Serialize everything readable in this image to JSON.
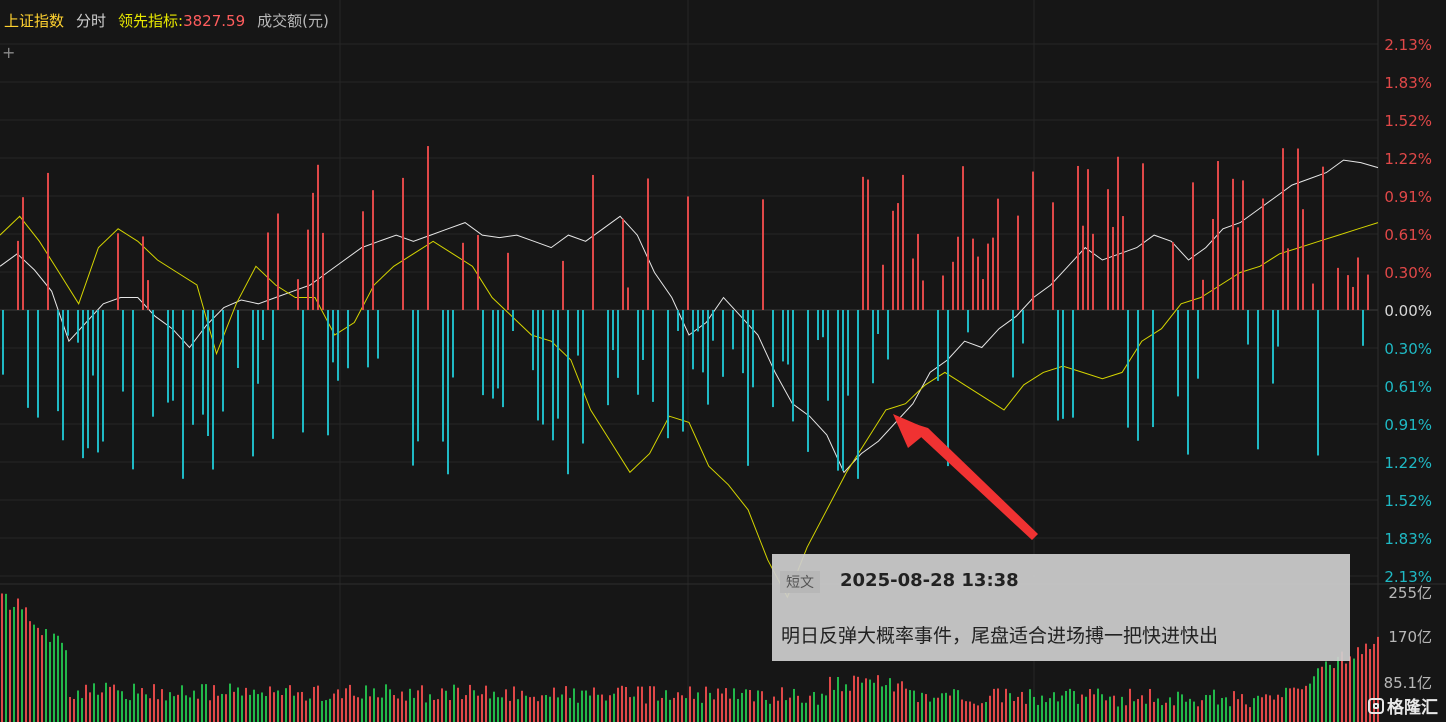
{
  "header": {
    "title": "上证指数",
    "mode": "分时",
    "leading_label": "领先指标:",
    "leading_value": "3827.59",
    "volume_label": "成交额(元)"
  },
  "chart_data": {
    "type": "line",
    "x": [
      0,
      3,
      6,
      9,
      12,
      15,
      18,
      21,
      24,
      27,
      30,
      33,
      36,
      39,
      42,
      45,
      48,
      51,
      54,
      57,
      60,
      63,
      66,
      69,
      72,
      75,
      78,
      81,
      84,
      87,
      90,
      93,
      96,
      99,
      102,
      105,
      108,
      111,
      114,
      117,
      120,
      123,
      126,
      129,
      132,
      135,
      138,
      141,
      144,
      147,
      150,
      153,
      156,
      159,
      162,
      165,
      168,
      171,
      174,
      177,
      180,
      183,
      186,
      189,
      192,
      195,
      198,
      201,
      204,
      207,
      210,
      213,
      216,
      219,
      222,
      225,
      228,
      231,
      234,
      237,
      240
    ],
    "y_range_pct": [
      -2.13,
      2.13
    ],
    "series": [
      {
        "color": "#e6e6e6",
        "values": [
          0.35,
          0.45,
          0.32,
          0.15,
          -0.25,
          -0.1,
          0.05,
          0.1,
          0.1,
          -0.05,
          -0.15,
          -0.3,
          -0.12,
          0.02,
          0.08,
          0.05,
          0.1,
          0.15,
          0.2,
          0.3,
          0.4,
          0.5,
          0.55,
          0.6,
          0.55,
          0.6,
          0.65,
          0.7,
          0.6,
          0.58,
          0.6,
          0.55,
          0.5,
          0.6,
          0.55,
          0.65,
          0.75,
          0.6,
          0.3,
          0.1,
          -0.2,
          -0.1,
          0.1,
          -0.05,
          -0.2,
          -0.5,
          -0.75,
          -0.85,
          -1.0,
          -1.3,
          -1.15,
          -1.05,
          -0.9,
          -0.75,
          -0.5,
          -0.4,
          -0.25,
          -0.3,
          -0.15,
          -0.05,
          0.1,
          0.2,
          0.35,
          0.5,
          0.4,
          0.45,
          0.5,
          0.6,
          0.55,
          0.4,
          0.5,
          0.65,
          0.7,
          0.8,
          0.9,
          1.0,
          1.05,
          1.1,
          1.2,
          1.18,
          1.14
        ]
      },
      {
        "color": "#d4d400",
        "values": [
          0.6,
          0.75,
          0.55,
          0.3,
          0.05,
          0.5,
          0.65,
          0.55,
          0.4,
          0.3,
          0.2,
          -0.35,
          0.05,
          0.35,
          0.2,
          0.1,
          0.1,
          -0.2,
          -0.1,
          0.2,
          0.35,
          0.45,
          0.55,
          0.45,
          0.35,
          0.1,
          -0.05,
          -0.2,
          -0.25,
          -0.4,
          -0.8,
          -1.05,
          -1.3,
          -1.15,
          -0.85,
          -0.9,
          -1.25,
          -1.4,
          -1.6,
          -2.0,
          -2.3,
          -1.9,
          -1.6,
          -1.3,
          -1.05,
          -0.8,
          -0.75,
          -0.6,
          -0.5,
          -0.6,
          -0.7,
          -0.8,
          -0.6,
          -0.5,
          -0.45,
          -0.5,
          -0.55,
          -0.5,
          -0.25,
          -0.15,
          0.05,
          0.1,
          0.2,
          0.3,
          0.35,
          0.45,
          0.5,
          0.55,
          0.6,
          0.65,
          0.7
        ]
      }
    ],
    "y_ticks": [
      "2.13%",
      "1.83%",
      "1.52%",
      "1.22%",
      "0.91%",
      "0.61%",
      "0.30%",
      "0.00%",
      "0.30%",
      "0.61%",
      "0.91%",
      "1.22%",
      "1.52%",
      "1.83%",
      "2.13%"
    ],
    "volume_ticks": [
      "255亿",
      "170亿",
      "85.1亿"
    ],
    "colors": {
      "up": "#e04848",
      "down": "#1fb9c4",
      "neutral": "#d8d8d8",
      "vol_up": "#e04848",
      "vol_down": "#22b84a",
      "arrow": "#f03232"
    }
  },
  "card": {
    "tag": "短文",
    "time": "2025-08-28 13:38",
    "text": "明日反弹大概率事件，尾盘适合进场搏一把快进快出"
  },
  "logo": {
    "text": "格隆汇"
  }
}
